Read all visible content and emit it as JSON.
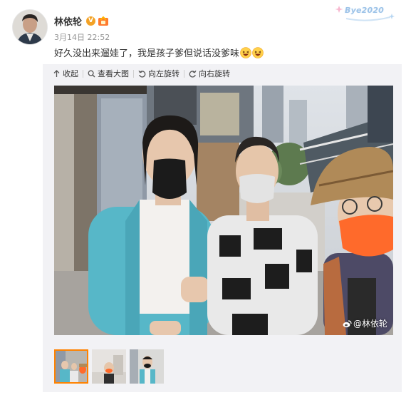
{
  "post": {
    "author": "林依轮",
    "verified_badge": "V",
    "timestamp": "3月14日 22:52",
    "text": "好久没出来遛娃了，我是孩子爹但说话没爹味",
    "emojis": [
      "laughing-face-emoji",
      "laughing-face-emoji"
    ],
    "decoration_text": "Bye2020"
  },
  "toolbar": {
    "collapse": "收起",
    "view_large": "查看大图",
    "rotate_left": "向左旋转",
    "rotate_right": "向右旋转"
  },
  "photo": {
    "watermark": "@林依轮"
  },
  "thumbnails": [
    {
      "active": true
    },
    {
      "active": false
    },
    {
      "active": false
    }
  ],
  "colors": {
    "accent_orange": "#ff8200",
    "panel_bg": "#f2f2f5",
    "verified": "#f3a226"
  }
}
